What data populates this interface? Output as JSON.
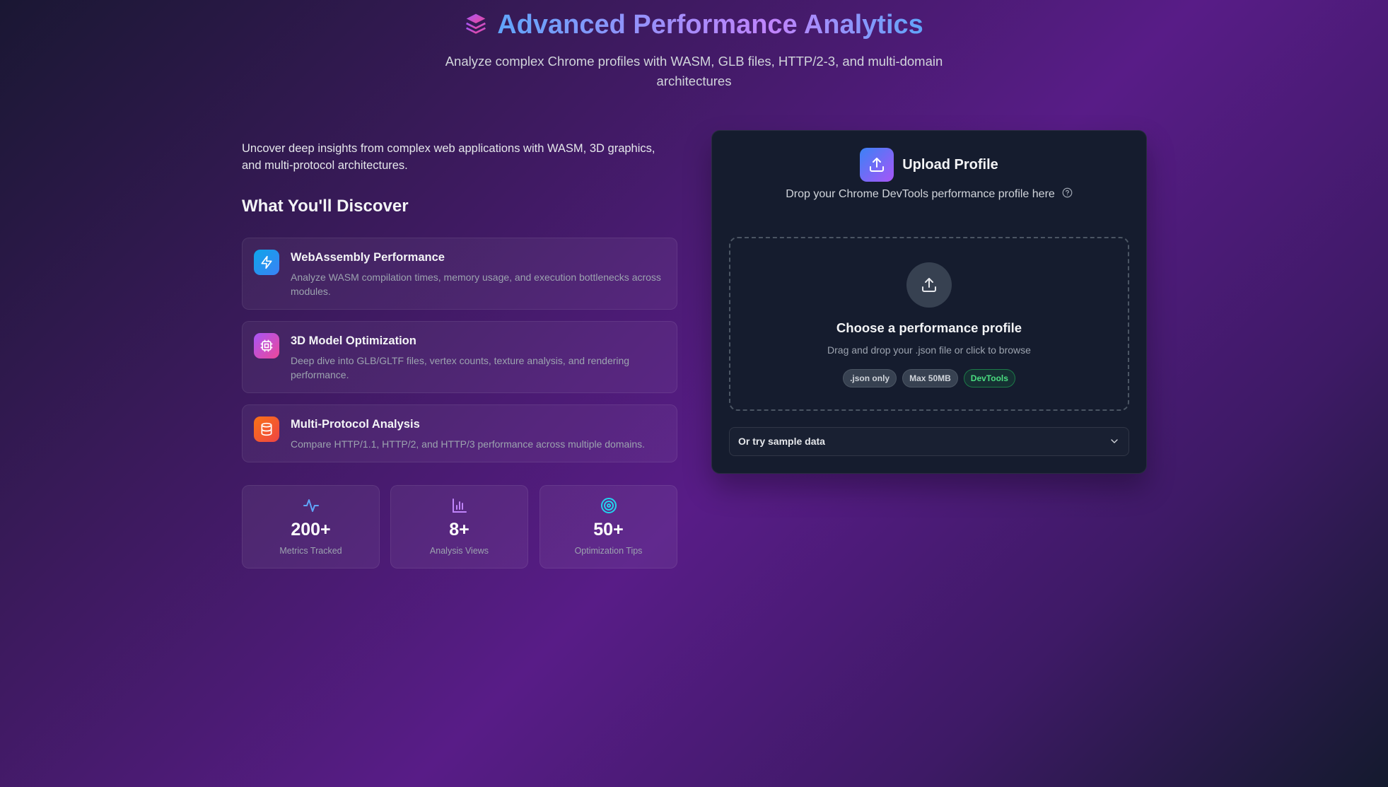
{
  "header": {
    "icon": "layers-icon",
    "title": "Advanced Performance Analytics",
    "subtitle": "Analyze complex Chrome profiles with WASM, GLB files, HTTP/2-3, and multi-domain architectures"
  },
  "intro": "Uncover deep insights from complex web applications with WASM, 3D graphics, and multi-protocol architectures.",
  "discover": {
    "title": "What You'll Discover",
    "features": [
      {
        "icon": "zap-icon",
        "title": "WebAssembly Performance",
        "description": "Analyze WASM compilation times, memory usage, and execution bottlenecks across modules.",
        "color_from": "#0ea5e9",
        "color_to": "#3b82f6"
      },
      {
        "icon": "cpu-icon",
        "title": "3D Model Optimization",
        "description": "Deep dive into GLB/GLTF files, vertex counts, texture analysis, and rendering performance.",
        "color_from": "#a855f7",
        "color_to": "#ec4899"
      },
      {
        "icon": "database-icon",
        "title": "Multi-Protocol Analysis",
        "description": "Compare HTTP/1.1, HTTP/2, and HTTP/3 performance across multiple domains.",
        "color_from": "#f97316",
        "color_to": "#ef4444"
      }
    ]
  },
  "stats": [
    {
      "icon": "activity-icon",
      "value": "200+",
      "label": "Metrics Tracked",
      "color": "#60a5fa"
    },
    {
      "icon": "bar-chart-icon",
      "value": "8+",
      "label": "Analysis Views",
      "color": "#c084fc"
    },
    {
      "icon": "target-icon",
      "value": "50+",
      "label": "Optimization Tips",
      "color": "#22d3ee"
    }
  ],
  "upload": {
    "title": "Upload Profile",
    "subtitle": "Drop your Chrome DevTools performance profile here",
    "dropzone_title": "Choose a performance profile",
    "dropzone_subtitle": "Drag and drop your .json file or click to browse",
    "tags": [
      ".json only",
      "Max 50MB",
      "DevTools"
    ],
    "sample_label": "Or try sample data"
  },
  "colors": {
    "accent_blue": "#60a5fa",
    "accent_purple": "#a855f7",
    "card_bg": "#151c2e",
    "success_green": "#4ade80"
  }
}
